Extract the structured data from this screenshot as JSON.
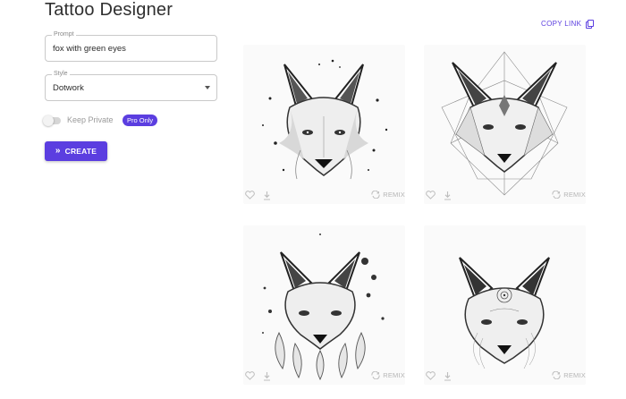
{
  "page": {
    "title": "Tattoo Designer"
  },
  "form": {
    "prompt": {
      "label": "Prompt",
      "value": "fox with green eyes"
    },
    "style": {
      "label": "Style",
      "value": "Dotwork"
    },
    "keep_private": {
      "label": "Keep Private",
      "badge": "Pro Only",
      "on": false
    },
    "create_label": "CREATE"
  },
  "share": {
    "copy_link_label": "COPY LINK"
  },
  "results": [
    {
      "remix_label": "REMIX"
    },
    {
      "remix_label": "REMIX"
    },
    {
      "remix_label": "REMIX"
    },
    {
      "remix_label": "REMIX"
    }
  ],
  "colors": {
    "accent": "#5b3ee0",
    "border": "#c9c9c9",
    "muted": "#b5b5b5"
  }
}
